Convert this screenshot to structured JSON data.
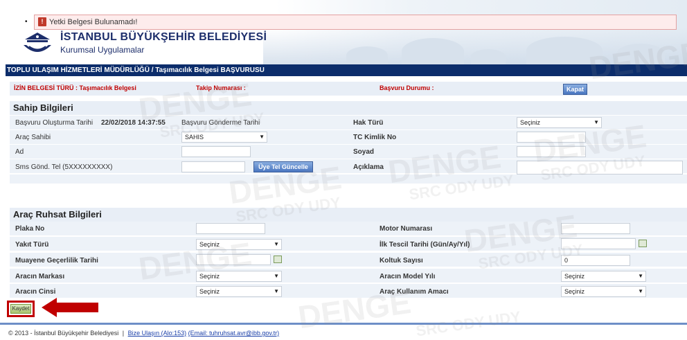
{
  "error": {
    "message": "Yetki Belgesi Bulunamadı!",
    "bullet": "•",
    "icon_glyph": "!"
  },
  "header": {
    "title": "İSTANBUL BÜYÜKŞEHİR BELEDİYESİ",
    "subtitle": "Kurumsal Uygulamalar"
  },
  "title_bar": "TOPLU ULAŞIM HİZMETLERİ MÜDÜRLÜĞÜ / Taşımacılık Belgesi BAŞVURUSU",
  "info": {
    "permit_type": "İZİN BELGESİ TÜRÜ : Taşımacılık Belgesi",
    "tracking": "Takip Numarası :",
    "status": "Başvuru Durumu :",
    "close_label": "Kapat"
  },
  "owner": {
    "section_title": "Sahip Bilgileri",
    "created_label": "Başvuru Oluşturma Tarihi",
    "created_value": "22/02/2018 14:37:55",
    "sent_label": "Başvuru Gönderme Tarihi",
    "right_type_label": "Hak Türü",
    "right_type_value": "Seçiniz",
    "vehicle_owner_label": "Araç Sahibi",
    "vehicle_owner_value": "SAHIS",
    "tc_label": "TC Kimlik No",
    "name_label": "Ad",
    "surname_label": "Soyad",
    "sms_label": "Sms Gönd. Tel (5XXXXXXXXX)",
    "update_phone_label": "Üye Tel Güncelle",
    "note_label": "Açıklama"
  },
  "vehicle": {
    "section_title": "Araç Ruhsat Bilgileri",
    "plate_label": "Plaka No",
    "engine_label": "Motor Numarası",
    "fuel_label": "Yakıt Türü",
    "fuel_value": "Seçiniz",
    "first_reg_label": "İlk Tescil Tarihi (Gün/Ay/Yıl)",
    "inspection_label": "Muayene Geçerlilik Tarihi",
    "seat_label": "Koltuk Sayısı",
    "seat_value": "0",
    "brand_label": "Aracın Markası",
    "brand_value": "Seçiniz",
    "model_year_label": "Aracın Model Yılı",
    "model_year_value": "Seçiniz",
    "kind_label": "Aracın Cinsi",
    "kind_value": "Seçiniz",
    "usage_label": "Araç Kullanım Amacı",
    "usage_value": "Seçiniz"
  },
  "actions": {
    "save_label": "Kaydet"
  },
  "footer": {
    "copyright": "© 2013 - İstanbul Büyükşehir Belediyesi",
    "separator": "|",
    "contact_link": "Bize Ulaşın (Alo:153)",
    "email_link": "(Email: tuhruhsat.avr@ibb.gov.tr)"
  },
  "watermark": {
    "line1": "DENGE",
    "line2": "SRC ODY UDY"
  },
  "icons": {
    "dropdown": "▼",
    "calendar": "calendar-icon"
  },
  "colors": {
    "title_bar": "#0c2d6b",
    "error_bg": "#fdecec",
    "alert_red": "#c00000",
    "brand": "#1d2e6b"
  }
}
